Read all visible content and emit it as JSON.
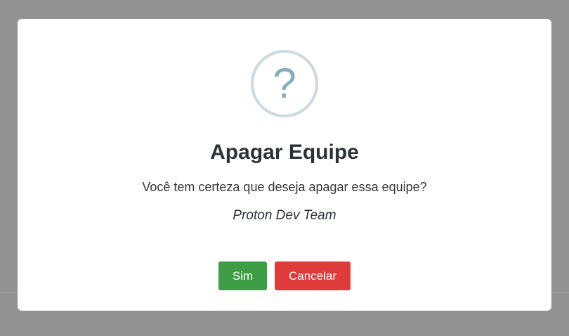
{
  "dialog": {
    "icon": "question-mark-icon",
    "icon_glyph": "?",
    "title": "Apagar Equipe",
    "message": "Você tem certeza que deseja apagar essa equipe?",
    "team_name": "Proton Dev Team",
    "confirm_label": "Sim",
    "cancel_label": "Cancelar"
  },
  "colors": {
    "backdrop": "#919293",
    "confirm": "#3f9e45",
    "cancel": "#e03b3b",
    "icon": "#87adbd",
    "icon_ring": "#c9dae1"
  }
}
